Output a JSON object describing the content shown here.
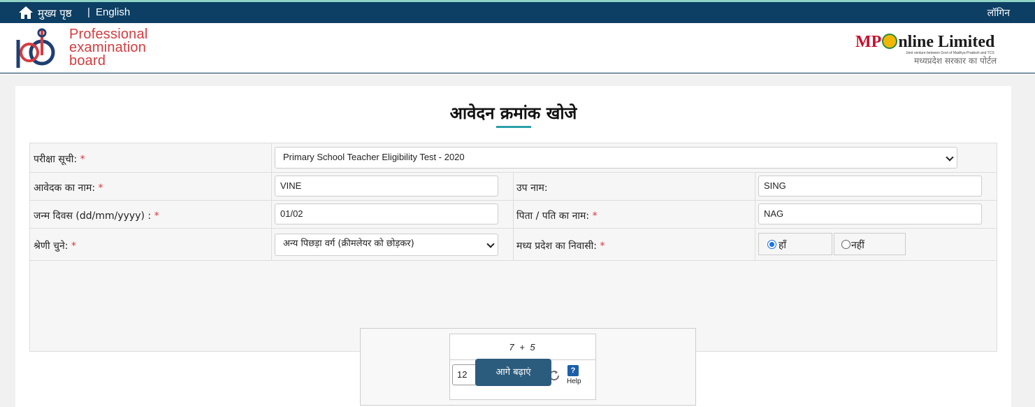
{
  "topbar": {
    "home_label": "मुख्य पृष्ठ",
    "separator": "|",
    "language": "English",
    "login": "लॉगिन",
    "background_color": "#0d3e63"
  },
  "header": {
    "peb_logo_text": [
      "Professional",
      "examination",
      "board"
    ],
    "mp_logo_prefix": "MP",
    "mp_logo_suffix": "nline Limited",
    "mp_logo_tagline": "Joint venture between Govt of Madhya Pradesh and TCS",
    "mp_logo_hindi": "मध्यप्रदेश सरकार का पोर्टल"
  },
  "page": {
    "title": "आवेदन क्रमांक खोजे"
  },
  "form": {
    "exam_list_label": "परीक्षा सूची:",
    "exam_list_value": "Primary School Teacher Eligibility Test - 2020",
    "applicant_name_label": "आवेदक का नाम:",
    "applicant_name_value": "VINE",
    "surname_label": "उप नाम:",
    "surname_value": "SING",
    "dob_label": "जन्म दिवस (dd/mm/yyyy) :",
    "dob_value": "01/02",
    "father_name_label": "पिता / पति का नाम:",
    "father_name_value": "NAG",
    "category_label": "श्रेणी चुने:",
    "category_value": "अन्य पिछड़ा वर्ग (क्रीमलेयर को छोड़कर)",
    "mp_resident_label": "मध्य प्रदेश का निवासी:",
    "mp_resident_options": [
      "हाँ",
      "नहीं"
    ],
    "mp_resident_selected": "हाँ",
    "required_marker": "*"
  },
  "captcha": {
    "equation": "7 + 5",
    "answer": "12",
    "help_icon": "?",
    "help_label": "Help"
  },
  "actions": {
    "submit_label": "आगे बढ़ाएं"
  },
  "colors": {
    "accent": "#2aa0a8",
    "required": "#d9333f",
    "button": "#2c5c7d",
    "peb_red": "#d63b3e"
  }
}
